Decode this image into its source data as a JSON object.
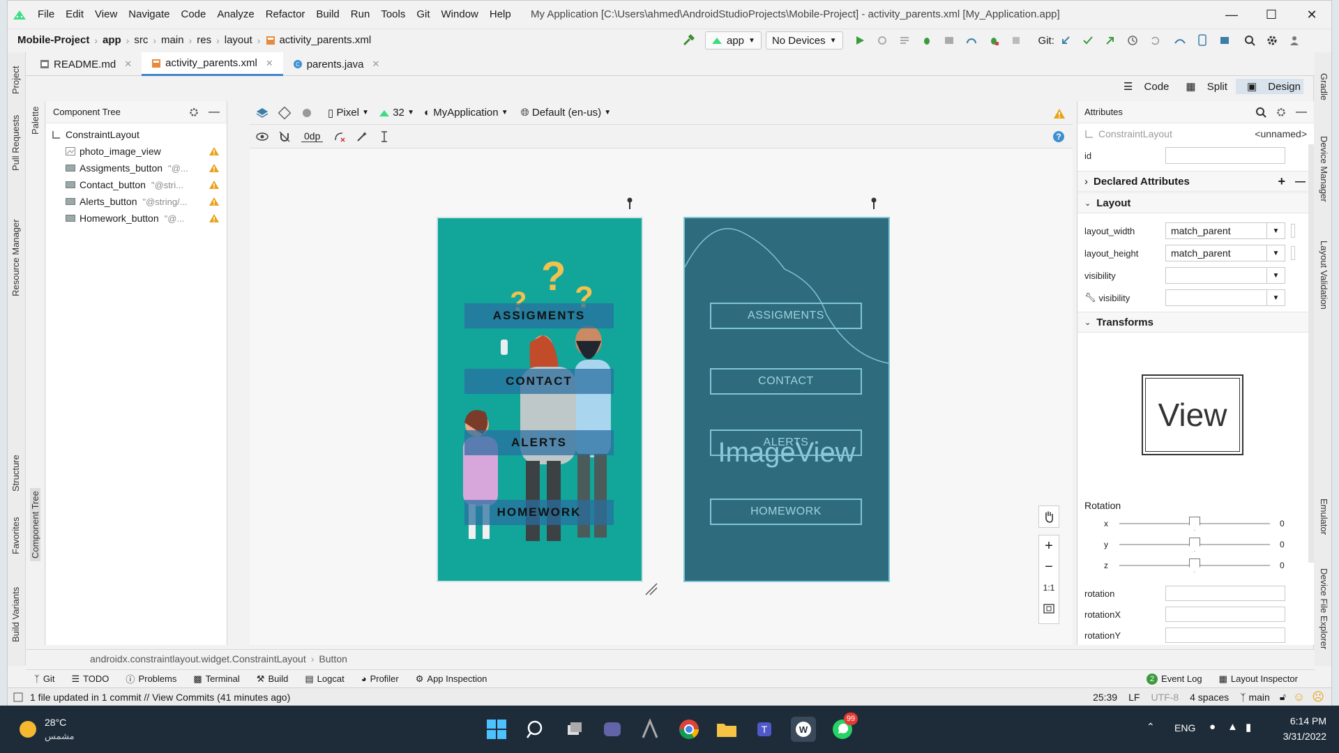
{
  "menu": {
    "items": [
      "File",
      "Edit",
      "View",
      "Navigate",
      "Code",
      "Analyze",
      "Refactor",
      "Build",
      "Run",
      "Tools",
      "Git",
      "Window",
      "Help"
    ],
    "window_title": "My Application [C:\\Users\\ahmed\\AndroidStudioProjects\\Mobile-Project] - activity_parents.xml [My_Application.app]"
  },
  "navbar": {
    "project": "Mobile-Project",
    "crumbs": [
      "app",
      "src",
      "main",
      "res",
      "layout",
      "activity_parents.xml"
    ],
    "run_config": "app",
    "device": "No Devices",
    "git_label": "Git:"
  },
  "left_stripe": [
    "Project",
    "Pull Requests",
    "Resource Manager",
    "Structure",
    "Favorites",
    "Build Variants"
  ],
  "right_stripe": [
    "Gradle",
    "Device Manager",
    "Layout Validation",
    "Emulator",
    "Device File Explorer"
  ],
  "tabs": [
    {
      "label": "README.md"
    },
    {
      "label": "activity_parents.xml"
    },
    {
      "label": "parents.java"
    }
  ],
  "view_modes": {
    "code": "Code",
    "split": "Split",
    "design": "Design"
  },
  "palette_label": "Palette",
  "component_tree_label": "Component Tree",
  "component_tree": {
    "title": "Component Tree",
    "root": "ConstraintLayout",
    "items": [
      {
        "name": "photo_image_view",
        "hint": ""
      },
      {
        "name": "Assigments_button",
        "hint": "\"@..."
      },
      {
        "name": "Contact_button",
        "hint": "\"@stri..."
      },
      {
        "name": "Alerts_button",
        "hint": "\"@string/..."
      },
      {
        "name": "Homework_button",
        "hint": "\"@..."
      }
    ]
  },
  "surface_toolbar": {
    "device": "Pixel",
    "api": "32",
    "theme": "MyApplication",
    "locale": "Default (en-us)",
    "margin": "0dp"
  },
  "design_preview": {
    "buttons": [
      "ASSIGMENTS",
      "CONTACT",
      "ALERTS",
      "HOMEWORK"
    ],
    "bg_color": "#12a59a"
  },
  "blueprint_preview": {
    "buttons": [
      "ASSIGMENTS",
      "CONTACT",
      "ALERTS",
      "HOMEWORK"
    ],
    "image_label": "ImageView",
    "bg_color": "#2e6b7d"
  },
  "zoom_controls": [
    "+",
    "−",
    "1:1"
  ],
  "attributes": {
    "title": "Attributes",
    "component": "ConstraintLayout",
    "component_name": "<unnamed>",
    "id_label": "id",
    "declared": "Declared Attributes",
    "layout_section": "Layout",
    "layout_width_label": "layout_width",
    "layout_width": "match_parent",
    "layout_height_label": "layout_height",
    "layout_height": "match_parent",
    "visibility_label": "visibility",
    "tools_visibility_label": "visibility",
    "transforms_section": "Transforms",
    "view_label": "View",
    "rotation_label": "Rotation",
    "rot_axes": [
      {
        "axis": "x",
        "value": "0"
      },
      {
        "axis": "y",
        "value": "0"
      },
      {
        "axis": "z",
        "value": "0"
      }
    ],
    "rotation_fields": [
      "rotation",
      "rotationX",
      "rotationY"
    ]
  },
  "bottom_breadcrumb": {
    "class": "androidx.constraintlayout.widget.ConstraintLayout",
    "child": "Button"
  },
  "tool_windows": [
    "Git",
    "TODO",
    "Problems",
    "Terminal",
    "Build",
    "Logcat",
    "Profiler",
    "App Inspection"
  ],
  "tool_windows_right": {
    "event_log": "Event Log",
    "event_count": "2",
    "layout_inspector": "Layout Inspector"
  },
  "status": {
    "message": "1 file updated in 1 commit // View Commits (41 minutes ago)",
    "position": "25:39",
    "line_sep": "LF",
    "encoding": "UTF-8",
    "indent": "4 spaces",
    "branch": "main"
  },
  "taskbar": {
    "temp": "28°C",
    "weather": "مشمس",
    "lang": "ENG",
    "time": "6:14 PM",
    "date": "3/31/2022",
    "whatsapp_badge": "99"
  },
  "colors": {
    "accent": "#4083c9",
    "warning": "#e8a317",
    "taskbar": "#1e2c3a"
  }
}
